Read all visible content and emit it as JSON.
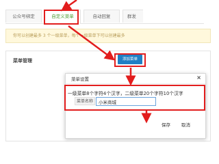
{
  "tabs": [
    {
      "label": "公众号绑定"
    },
    {
      "label": "自定义菜单"
    },
    {
      "label": "自动回复"
    },
    {
      "label": "群发"
    }
  ],
  "notice": "你可以创建最多 3 个一级菜单，每个一级菜单下可以创建最多",
  "panel": {
    "title": "菜单管理",
    "add_button": "添加菜单"
  },
  "dialog": {
    "title": "菜单设置",
    "close": "×",
    "hint": "一级菜单8个字符4个汉字，二级菜单20个字符10个汉字",
    "field_label": "菜单名称",
    "field_value": "小米商城",
    "save": "保存",
    "cancel": "取消"
  },
  "colors": {
    "highlight": "#e21d1d",
    "active_tab": "#4a9a2e",
    "primary_button": "#1f7fc4",
    "notice_bg": "#fff8dc"
  }
}
